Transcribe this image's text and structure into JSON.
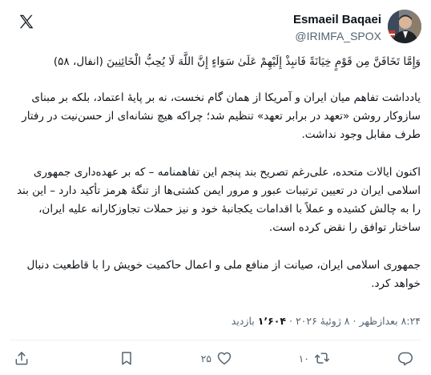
{
  "author": {
    "name": "Esmaeil Baqaei",
    "handle": "@IRIMFA_SPOX"
  },
  "icons": {
    "logo": "x-logo-icon",
    "avatar": "avatar-image",
    "reply": "reply-icon",
    "retweet": "retweet-icon",
    "like": "heart-icon",
    "bookmark": "bookmark-icon",
    "share": "share-icon"
  },
  "post": {
    "verse": "وَإِمَّا تَخَافَنَّ مِن قَوْمٍ خِيَانَةً فَانبِذْ إِلَيْهِمْ عَلَىٰ سَوَاءٍ إِنَّ اللَّهَ لَا يُحِبُّ الْخَائِنِينَ (انفال، ۵۸)",
    "paragraphs": [
      "یادداشت تفاهم میان ایران و آمریکا از همان گام نخست، نه بر پایهٔ اعتماد، بلکه بر مبنای سازوکار روشن «تعهد در برابر تعهد» تنظیم شد؛ چراکه هیچ نشانه‌ای از حسن‌نیت در رفتار طرف مقابل وجود نداشت.",
      "اکنون ایالات متحده، علی‌رغم تصریح بند پنجم این تفاهمنامه – که بر عهده‌داری جمهوری اسلامی ایران در تعیین ترتیبات عبور و مرور ایمن کشتی‌ها از تنگهٔ هرمز تأکید دارد – این بند را به چالش کشیده و عملاً با اقدامات یکجانبهٔ خود و نیز حملات تجاوزکارانه علیه ایران، ساختار توافق را نقض کرده است.",
      "جمهوری اسلامی ایران، صیانت از منافع ملی و اعمال حاکمیت خویش را با قاطعیت دنبال خواهد کرد."
    ]
  },
  "meta": {
    "time": "۸:۲۴ بعدازظهر",
    "separator": "·",
    "date": "۸ ژوئیهٔ ۲۰۲۶",
    "views_count": "۱٬۶۰۴",
    "views_label": "بازدید"
  },
  "actions": {
    "reply_count": "",
    "retweet_count": "۱۰",
    "like_count": "۲۵",
    "bookmark_count": ""
  },
  "colors": {
    "text": "#0f1419",
    "secondary": "#536471",
    "divider": "#eff3f4"
  }
}
